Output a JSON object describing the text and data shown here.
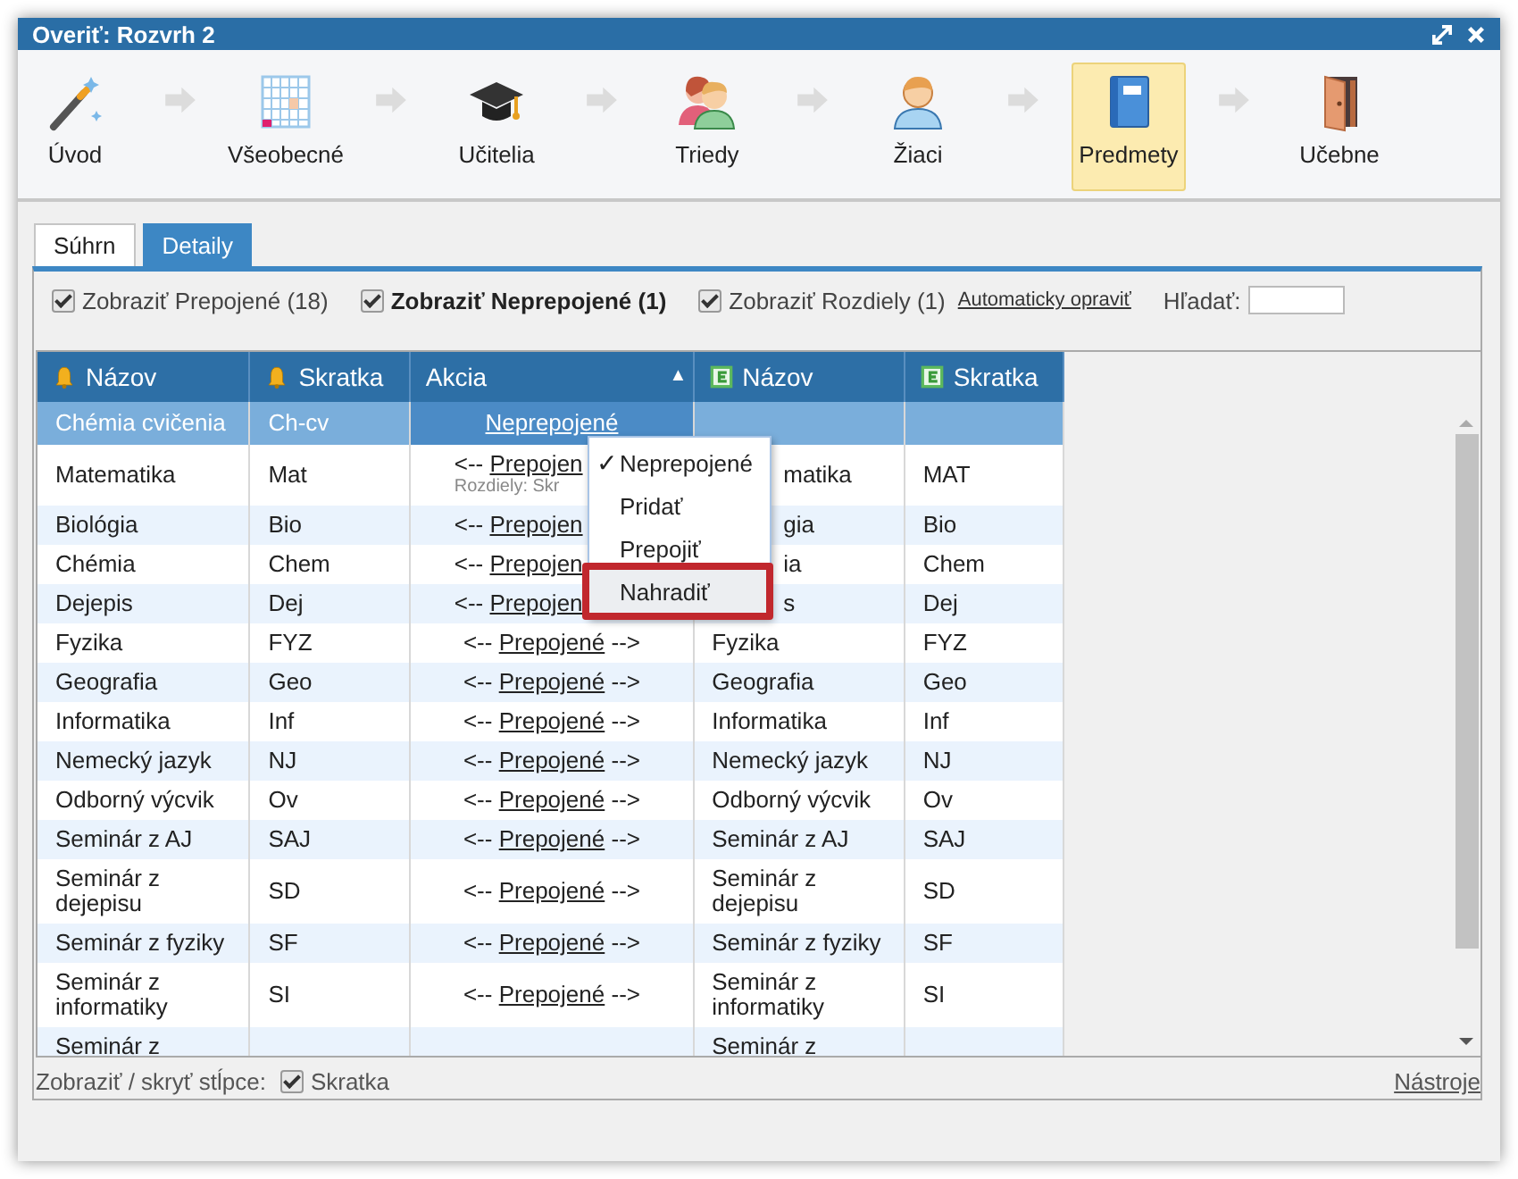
{
  "window": {
    "title": "Overiť: Rozvrh 2"
  },
  "steps": [
    {
      "label": "Úvod",
      "selected": false
    },
    {
      "label": "Všeobecné",
      "selected": false
    },
    {
      "label": "Učitelia",
      "selected": false
    },
    {
      "label": "Triedy",
      "selected": false
    },
    {
      "label": "Žiaci",
      "selected": false
    },
    {
      "label": "Predmety",
      "selected": true
    },
    {
      "label": "Učebne",
      "selected": false
    }
  ],
  "tabs": [
    {
      "label": "Súhrn",
      "selected": false
    },
    {
      "label": "Detaily",
      "selected": true
    }
  ],
  "filters": [
    {
      "label": "Zobraziť Prepojené (18)",
      "checked": true,
      "bold": false
    },
    {
      "label": "Zobraziť Neprepojené (1)",
      "checked": true,
      "bold": true
    },
    {
      "label": "Zobraziť Rozdiely (1)",
      "checked": true,
      "bold": false
    }
  ],
  "auto_fix_link": "Automaticky opraviť",
  "search": {
    "label": "Hľadať:"
  },
  "table": {
    "columns": [
      {
        "label": "Názov",
        "kind": "left",
        "sorted": false
      },
      {
        "label": "Skratka",
        "kind": "left",
        "sorted": false
      },
      {
        "label": "Akcia",
        "kind": "action",
        "sorted": true
      },
      {
        "label": "Názov",
        "kind": "right",
        "sorted": false
      },
      {
        "label": "Skratka",
        "kind": "right",
        "sorted": false
      }
    ],
    "sort_mark": "▲",
    "rows": [
      {
        "selected": true,
        "name": "Chémia cvičenia",
        "abbr": "Ch-cv",
        "action": {
          "link": "Neprepojené"
        }
      },
      {
        "selected": false,
        "name": "Matematika",
        "abbr": "Mat",
        "action": {
          "before": "<--",
          "link": "Prepojen",
          "note": "Rozdiely: Skr",
          "under_menu": true
        },
        "right_name": {
          "text": "matika",
          "under_menu": true
        },
        "right_abbr": "MAT"
      },
      {
        "selected": false,
        "name": "Biológia",
        "abbr": "Bio",
        "action": {
          "before": "<--",
          "link": "Prepojen",
          "under_menu": true
        },
        "right_name": {
          "text": "gia",
          "under_menu": true
        },
        "right_abbr": "Bio"
      },
      {
        "selected": false,
        "name": "Chémia",
        "abbr": "Chem",
        "action": {
          "before": "<--",
          "link": "Prepojen",
          "under_menu": true
        },
        "right_name": {
          "text": "ia",
          "under_menu": true
        },
        "right_abbr": "Chem"
      },
      {
        "selected": false,
        "name": "Dejepis",
        "abbr": "Dej",
        "action": {
          "before": "<--",
          "link": "Prepojen",
          "under_menu": true
        },
        "right_name": {
          "text": "s",
          "under_menu": true
        },
        "right_abbr": "Dej"
      },
      {
        "selected": false,
        "name": "Fyzika",
        "abbr": "FYZ",
        "action": {
          "before": "<--",
          "link": "Prepojené",
          "after": "-->"
        },
        "right_name": {
          "text": "Fyzika"
        },
        "right_abbr": "FYZ"
      },
      {
        "selected": false,
        "name": "Geografia",
        "abbr": "Geo",
        "action": {
          "before": "<--",
          "link": "Prepojené",
          "after": "-->"
        },
        "right_name": {
          "text": "Geografia"
        },
        "right_abbr": "Geo"
      },
      {
        "selected": false,
        "name": "Informatika",
        "abbr": "Inf",
        "action": {
          "before": "<--",
          "link": "Prepojené",
          "after": "-->"
        },
        "right_name": {
          "text": "Informatika"
        },
        "right_abbr": "Inf"
      },
      {
        "selected": false,
        "name": "Nemecký jazyk",
        "abbr": "NJ",
        "action": {
          "before": "<--",
          "link": "Prepojené",
          "after": "-->"
        },
        "right_name": {
          "text": "Nemecký jazyk"
        },
        "right_abbr": "NJ"
      },
      {
        "selected": false,
        "name": "Odborný výcvik",
        "abbr": "Ov",
        "action": {
          "before": "<--",
          "link": "Prepojené",
          "after": "-->"
        },
        "right_name": {
          "text": "Odborný výcvik"
        },
        "right_abbr": "Ov"
      },
      {
        "selected": false,
        "name": "Seminár z AJ",
        "abbr": "SAJ",
        "action": {
          "before": "<--",
          "link": "Prepojené",
          "after": "-->"
        },
        "right_name": {
          "text": "Seminár z AJ"
        },
        "right_abbr": "SAJ"
      },
      {
        "selected": false,
        "name": "Seminár z dejepisu",
        "abbr": "SD",
        "action": {
          "before": "<--",
          "link": "Prepojené",
          "after": "-->"
        },
        "right_name": {
          "text": "Seminár z dejepisu"
        },
        "right_abbr": "SD"
      },
      {
        "selected": false,
        "name": "Seminár z fyziky",
        "abbr": "SF",
        "action": {
          "before": "<--",
          "link": "Prepojené",
          "after": "-->"
        },
        "right_name": {
          "text": "Seminár z fyziky"
        },
        "right_abbr": "SF"
      },
      {
        "selected": false,
        "name": "Seminár z informatiky",
        "abbr": "SI",
        "action": {
          "before": "<--",
          "link": "Prepojené",
          "after": "-->"
        },
        "right_name": {
          "text": "Seminár z informatiky"
        },
        "right_abbr": "SI"
      },
      {
        "selected": false,
        "name": "Seminár z",
        "right_name": {
          "text": "Seminár z"
        }
      }
    ]
  },
  "menu": {
    "check_mark": "✓",
    "items": [
      {
        "label": "Neprepojené",
        "checked": true,
        "highlighted": false
      },
      {
        "label": "Pridať",
        "checked": false,
        "highlighted": false
      },
      {
        "label": "Prepojiť",
        "checked": false,
        "highlighted": false
      },
      {
        "label": "Nahradiť",
        "checked": false,
        "highlighted": true
      }
    ]
  },
  "footer": {
    "label": "Zobraziť / skryť stĺpce:",
    "column_toggle": {
      "label": "Skratka",
      "checked": true
    },
    "tools_link": "Nástroje"
  }
}
